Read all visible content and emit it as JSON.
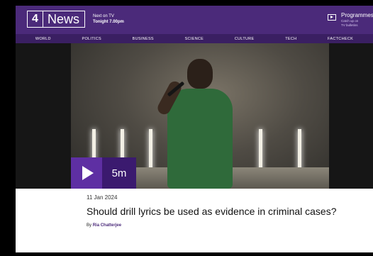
{
  "header": {
    "logo_number": "4",
    "logo_text": "News",
    "next_on_label": "Next on TV",
    "next_on_time": "Tonight 7.00pm",
    "programmes_title": "Programmes",
    "programmes_sub_1": "Catch up on",
    "programmes_sub_2": "TV bulletins"
  },
  "nav": {
    "items": [
      "WORLD",
      "POLITICS",
      "BUSINESS",
      "SCIENCE",
      "CULTURE",
      "TECH",
      "FACTCHECK"
    ]
  },
  "video": {
    "duration": "5m"
  },
  "article": {
    "date": "11 Jan 2024",
    "headline": "Should drill lyrics be used as evidence in criminal cases?",
    "by_label": "By",
    "author": "Ria Chatterjee"
  },
  "colors": {
    "header_bg": "#4b2a7a",
    "nav_bg": "#3a1f62",
    "play_bg": "#5e2fa3",
    "duration_bg": "#3b1a6f"
  }
}
